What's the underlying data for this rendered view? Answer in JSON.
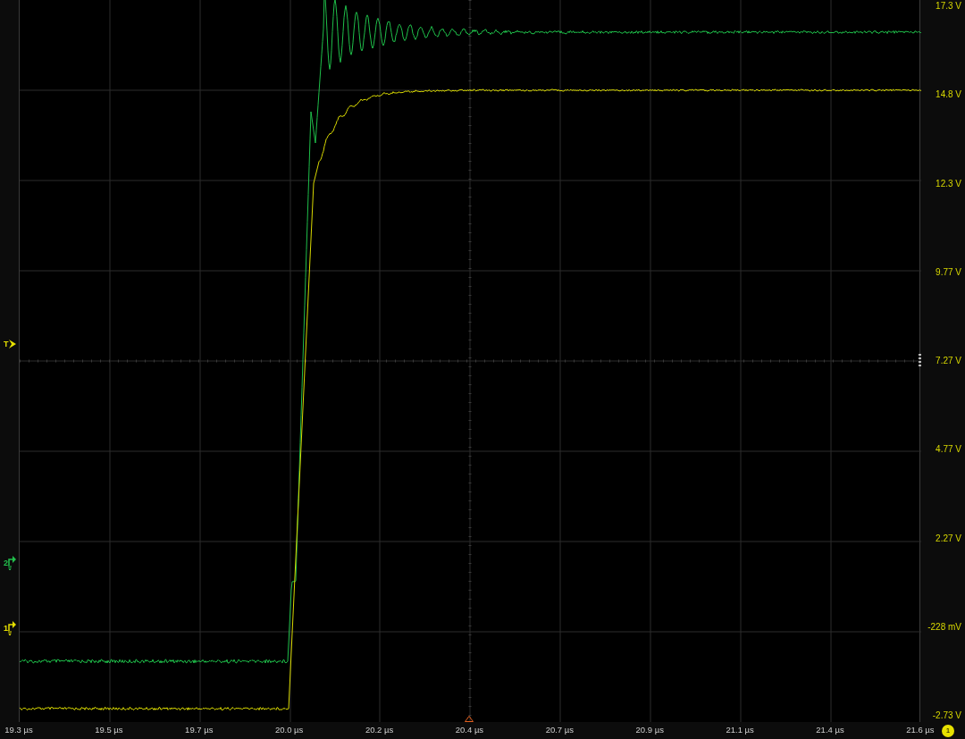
{
  "channel_markers": [
    {
      "label": "T",
      "kind": "trigger",
      "color": "#e6e000"
    },
    {
      "label": "2",
      "kind": "channel",
      "color": "#22c04c"
    },
    {
      "label": "1",
      "kind": "channel",
      "color": "#e6e000"
    }
  ],
  "y_axis": {
    "labels": [
      "17.3 V",
      "14.8 V",
      "12.3 V",
      "9.77 V",
      "7.27 V",
      "4.77 V",
      "2.27 V",
      "-228 mV",
      "-2.73 V"
    ]
  },
  "x_axis": {
    "labels": [
      "19.3 µs",
      "19.5 µs",
      "19.7 µs",
      "20.0 µs",
      "20.2 µs",
      "20.4 µs",
      "20.7 µs",
      "20.9 µs",
      "21.1 µs",
      "21.4 µs",
      "21.6 µs"
    ]
  },
  "channel_badge": "1"
}
